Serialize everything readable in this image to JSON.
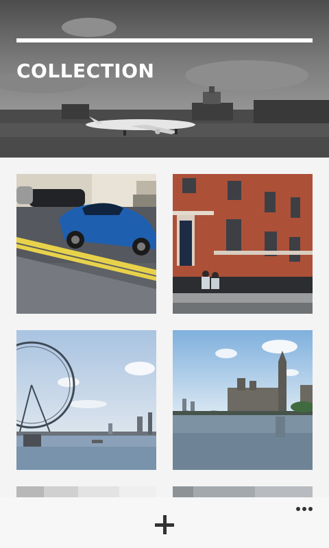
{
  "header": {
    "title": "COLLECTION",
    "image": "airport-runway-plane"
  },
  "gallery": {
    "items": [
      {
        "image": "blue-sports-car-on-street"
      },
      {
        "image": "red-brick-townhouses"
      },
      {
        "image": "london-eye-thames"
      },
      {
        "image": "westminster-big-ben-thames"
      },
      {
        "image": "interior-partial"
      },
      {
        "image": "gray-partial"
      }
    ]
  },
  "bottom_bar": {
    "add_icon": "plus-icon",
    "more_icon": "more-dots-icon"
  },
  "colors": {
    "header_overlay": "#6b6b6b",
    "icon": "#333333",
    "background": "#f4f4f4",
    "title": "#ffffff"
  }
}
